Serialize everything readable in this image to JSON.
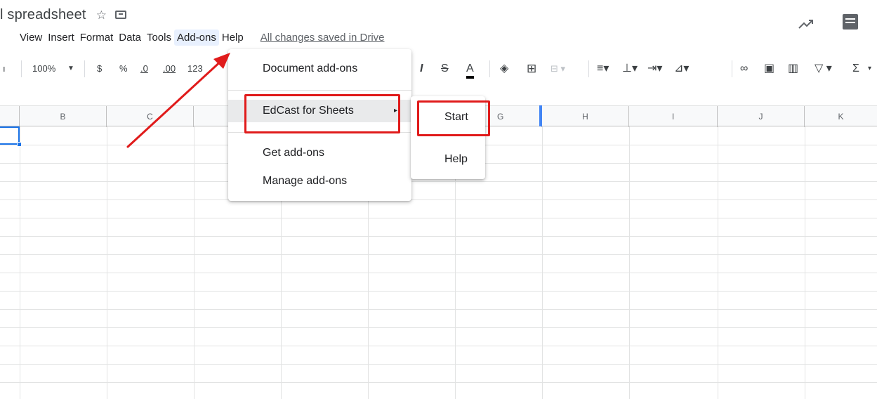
{
  "title": {
    "doc_name": "l spreadsheet",
    "star_icon": "star-icon",
    "folder_icon": "move-folder-icon"
  },
  "menubar": {
    "items": [
      "View",
      "Insert",
      "Format",
      "Data",
      "Tools",
      "Add-ons",
      "Help"
    ],
    "active": "Add-ons",
    "saved_status": "All changes saved in Drive"
  },
  "toolbar": {
    "zoom": "100%",
    "currency": "$",
    "percent": "%",
    "decrease_decimal": ".0",
    "increase_decimal": ".00",
    "more_formats": "123",
    "italic": "I",
    "strike": "S",
    "text_color": "A",
    "sigma": "Σ"
  },
  "columns": [
    "B",
    "C",
    "",
    "",
    "",
    "G",
    "H",
    "I",
    "J",
    "K"
  ],
  "dropdown": {
    "items": [
      {
        "label": "Document add-ons"
      },
      {
        "label": "EdCast for Sheets",
        "submenu": true
      },
      {
        "label": "Get add-ons"
      },
      {
        "label": "Manage add-ons"
      }
    ],
    "submenu_arrow": "▸"
  },
  "submenu": {
    "items": [
      {
        "label": "Start"
      },
      {
        "label": "Help"
      }
    ]
  },
  "colors": {
    "annotation_red": "#e01b1b",
    "selection_blue": "#1a73e8",
    "menu_active_bg": "#e8f0fe"
  }
}
